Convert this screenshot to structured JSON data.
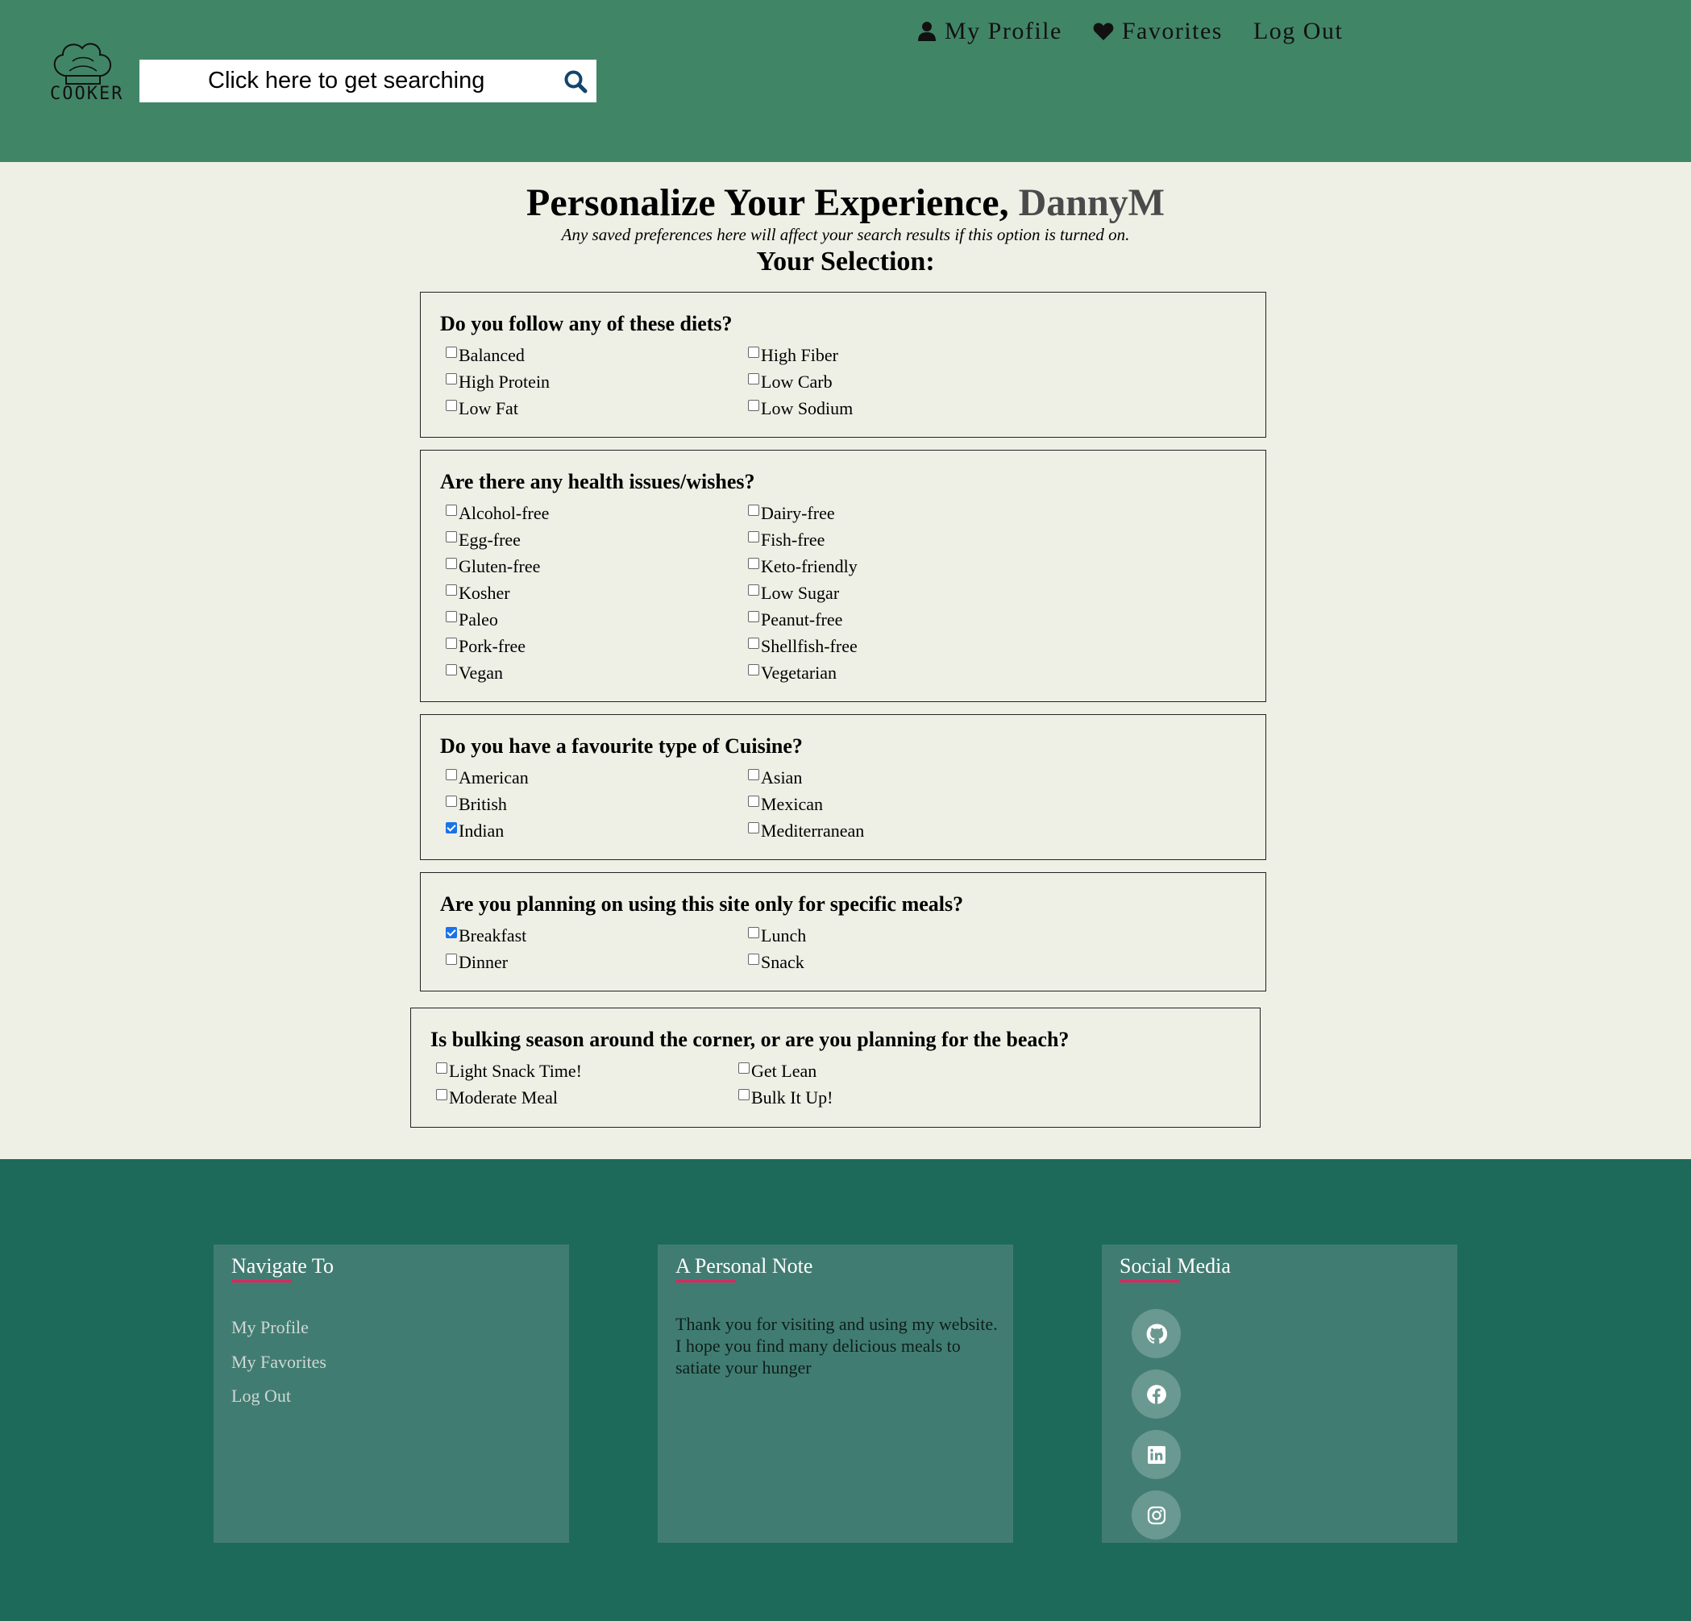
{
  "header": {
    "logo_text": "COOKER",
    "search_placeholder": "Click here to get searching",
    "nav": [
      {
        "label": "My Profile",
        "icon": "user-icon"
      },
      {
        "label": "Favorites",
        "icon": "heart-icon"
      },
      {
        "label": "Log Out"
      }
    ]
  },
  "main": {
    "title_prefix": "Personalize Your Experience,",
    "username": "DannyM",
    "subtitle": "Any saved preferences here will affect your search results if this option is turned on.",
    "selection_heading": "Your Selection:",
    "sections": [
      {
        "question": "Do you follow any of these diets?",
        "options": [
          {
            "label": "Balanced",
            "checked": false
          },
          {
            "label": "High Fiber",
            "checked": false
          },
          {
            "label": "High Protein",
            "checked": false
          },
          {
            "label": "Low Carb",
            "checked": false
          },
          {
            "label": "Low Fat",
            "checked": false
          },
          {
            "label": "Low Sodium",
            "checked": false
          }
        ]
      },
      {
        "question": "Are there any health issues/wishes?",
        "options": [
          {
            "label": "Alcohol-free",
            "checked": false
          },
          {
            "label": "Dairy-free",
            "checked": false
          },
          {
            "label": "Egg-free",
            "checked": false
          },
          {
            "label": "Fish-free",
            "checked": false
          },
          {
            "label": "Gluten-free",
            "checked": false
          },
          {
            "label": "Keto-friendly",
            "checked": false
          },
          {
            "label": "Kosher",
            "checked": false
          },
          {
            "label": "Low Sugar",
            "checked": false
          },
          {
            "label": "Paleo",
            "checked": false
          },
          {
            "label": "Peanut-free",
            "checked": false
          },
          {
            "label": "Pork-free",
            "checked": false
          },
          {
            "label": "Shellfish-free",
            "checked": false
          },
          {
            "label": "Vegan",
            "checked": false
          },
          {
            "label": "Vegetarian",
            "checked": false
          }
        ]
      },
      {
        "question": "Do you have a favourite type of Cuisine?",
        "options": [
          {
            "label": "American",
            "checked": false
          },
          {
            "label": "Asian",
            "checked": false
          },
          {
            "label": "British",
            "checked": false
          },
          {
            "label": "Mexican",
            "checked": false
          },
          {
            "label": "Indian",
            "checked": true
          },
          {
            "label": "Mediterranean",
            "checked": false
          }
        ]
      },
      {
        "question": "Are you planning on using this site only for specific meals?",
        "options": [
          {
            "label": "Breakfast",
            "checked": true
          },
          {
            "label": "Lunch",
            "checked": false
          },
          {
            "label": "Dinner",
            "checked": false
          },
          {
            "label": "Snack",
            "checked": false
          }
        ]
      },
      {
        "question": "Is bulking season around the corner, or are you planning for the beach?",
        "options": [
          {
            "label": "Light Snack Time!",
            "checked": false
          },
          {
            "label": "Get Lean",
            "checked": false
          },
          {
            "label": "Moderate Meal",
            "checked": false
          },
          {
            "label": "Bulk It Up!",
            "checked": false
          }
        ]
      }
    ]
  },
  "footer": {
    "navigate": {
      "heading": "Navigate To",
      "links": [
        "My Profile",
        "My Favorites",
        "Log Out"
      ]
    },
    "note": {
      "heading": "A Personal Note",
      "text": "Thank you for visiting and using my website. I hope you find many delicious meals to satiate your hunger"
    },
    "social": {
      "heading": "Social Media",
      "icons": [
        "github-icon",
        "facebook-icon",
        "linkedin-icon",
        "instagram-icon"
      ]
    }
  },
  "colors": {
    "header_bg": "#418567",
    "page_bg": "#eef0e6",
    "footer_bg": "#1d6a5b",
    "footer_card_bg": "#417c72",
    "accent_line": "#e0245e",
    "checkbox_checked": "#1a73e8"
  }
}
